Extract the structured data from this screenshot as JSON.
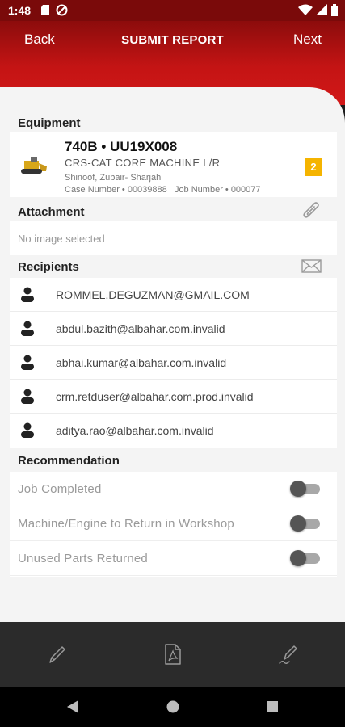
{
  "status_bar": {
    "time": "1:48"
  },
  "header": {
    "back_label": "Back",
    "title": "SUBMIT REPORT",
    "next_label": "Next"
  },
  "equipment": {
    "section_title": "Equipment",
    "name": "740B • UU19X008",
    "machine": "CRS-CAT CORE MACHINE L/R",
    "location": "Shinoof, Zubair- Sharjah",
    "case_number": "Case Number • 00039888",
    "job_number": "Job Number • 000077",
    "badge": "2",
    "badge_color": "#f5b400"
  },
  "attachment": {
    "section_title": "Attachment",
    "empty_text": "No image selected",
    "icon": "paperclip-icon"
  },
  "recipients": {
    "section_title": "Recipients",
    "icon": "envelope-icon",
    "items": [
      {
        "email": "ROMMEL.DEGUZMAN@GMAIL.COM"
      },
      {
        "email": "abdul.bazith@albahar.com.invalid"
      },
      {
        "email": "abhai.kumar@albahar.com.invalid"
      },
      {
        "email": "crm.retduser@albahar.com.prod.invalid"
      },
      {
        "email": "aditya.rao@albahar.com.invalid"
      }
    ]
  },
  "recommendation": {
    "section_title": "Recommendation",
    "items": [
      {
        "label": "Job Completed",
        "on": false
      },
      {
        "label": "Machine/Engine to Return in Workshop",
        "on": false
      },
      {
        "label": "Unused Parts Returned",
        "on": false
      }
    ]
  },
  "toolbar": {
    "tools": [
      "pencil-icon",
      "pdf-file-icon",
      "signature-pen-icon"
    ]
  },
  "colors": {
    "header_dark": "#8c0c0c",
    "header_light": "#d21818",
    "toolbar": "#2b2b2b"
  }
}
